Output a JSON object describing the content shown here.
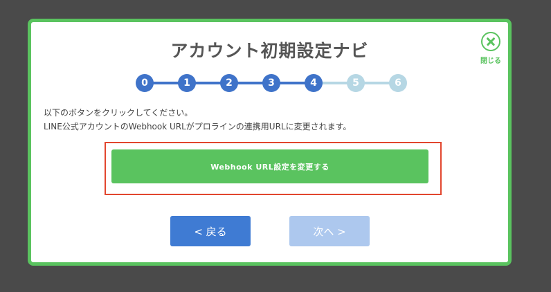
{
  "dialog": {
    "title": "アカウント初期設定ナビ",
    "close_label": "閉じる"
  },
  "stepper": {
    "current_step": 4,
    "steps": [
      "0",
      "1",
      "2",
      "3",
      "4",
      "5",
      "6"
    ]
  },
  "description": {
    "line1": "以下のボタンをクリックしてください。",
    "line2": "LINE公式アカウントのWebhook URLがプロラインの連携用URLに変更されます。"
  },
  "actions": {
    "webhook_button": "Webhook URL設定を変更する",
    "back_button": "< 戻る",
    "next_button": "次へ >"
  },
  "colors": {
    "accent_green": "#5ac35f",
    "step_active": "#3f73c9",
    "step_inactive": "#b6d7e4",
    "highlight_red": "#e2462e",
    "back_button": "#3f7bd3",
    "next_button_disabled": "#adc8ee"
  }
}
